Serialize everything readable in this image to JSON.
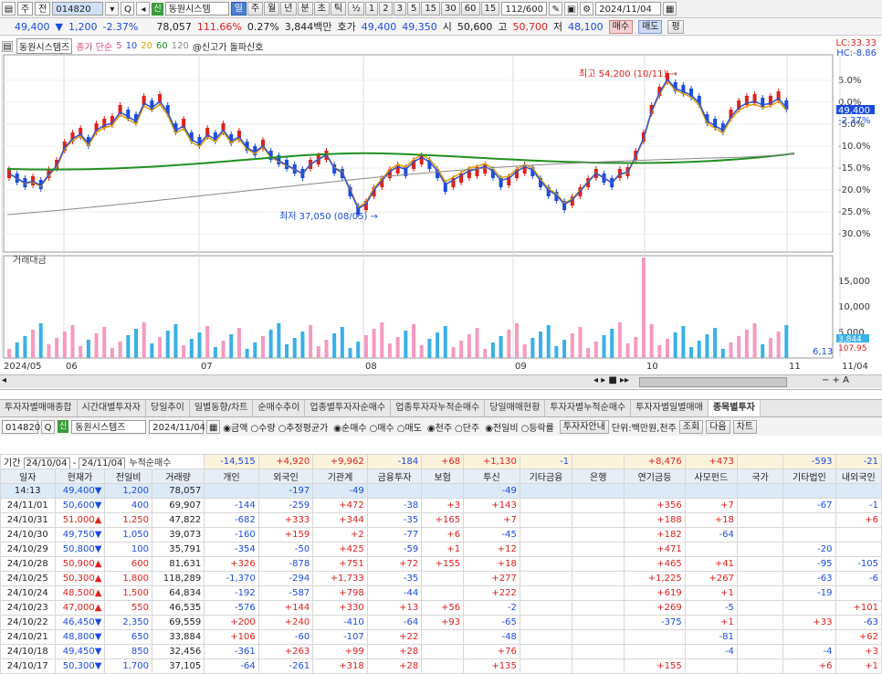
{
  "toolbar": {
    "mode": "주",
    "market": "전",
    "code": "014820",
    "name": "동원시스템",
    "periods": [
      "일",
      "주",
      "월",
      "년",
      "분",
      "초",
      "틱"
    ],
    "minutes": [
      "½",
      "1",
      "2",
      "3",
      "5",
      "15",
      "30",
      "60",
      "15"
    ],
    "count": "112/600",
    "date": "2024/11/04"
  },
  "info": {
    "price": "49,400",
    "change": "1,200",
    "rate": "-2.37%",
    "volume": "78,057",
    "vol_rate": "111.66%",
    "turnover": "0.27%",
    "amount": "3,844백만",
    "ask_label": "호가",
    "ask": "49,400",
    "bid": "49,350",
    "open_label": "시",
    "open": "50,600",
    "high_label": "고",
    "high": "50,700",
    "low_label": "저",
    "low": "48,100",
    "buy": "매수",
    "sell": "매도",
    "eval": "평"
  },
  "legend": {
    "name": "동원시스템즈",
    "ma_label": "종가 단순",
    "ma": [
      "5",
      "10",
      "20",
      "60",
      "120"
    ],
    "note": "@신고가 돌파신호",
    "lc": "LC:33.33",
    "hc": "HC:-8.86",
    "max_label": "최고 54,200 (10/11)",
    "min_label": "최저 37,050 (08/05)",
    "price_tag": "49,400",
    "price_rate": "-2.37%",
    "vol_title": "거래대금",
    "vol_tag": "3,844",
    "vol_rate_tag": "107.95",
    "vol_small": "6,13"
  },
  "chart_data": {
    "type": "candlestick",
    "y_pct_ticks": [
      "5.0%",
      "0.0%",
      "-5.0%",
      "-10.0%",
      "-15.0%",
      "-20.0%",
      "-25.0%",
      "-30.0%"
    ],
    "vol_ticks": [
      "15,000",
      "10,000",
      "5,000"
    ],
    "x_ticks": [
      "2024/05",
      "06",
      "07",
      "08",
      "09",
      "10",
      "11",
      "11/04"
    ]
  },
  "tabs": [
    "투자자별매매종합",
    "시간대별투자자",
    "당일추이",
    "일별동향/차트",
    "순매수추이",
    "업종별투자자순매수",
    "업종투자자누적순매수",
    "당일매매현황",
    "투자자별누적순매수",
    "투자자별일별매매",
    "종목별투자"
  ],
  "filter": {
    "code": "014820",
    "name": "동원시스템즈",
    "date": "2024/11/04",
    "r1": [
      "금액",
      "수량",
      "추정평균가"
    ],
    "r2": [
      "순매수",
      "매수",
      "매도"
    ],
    "r3": [
      "천주",
      "단주"
    ],
    "r4": [
      "전일비",
      "등락률"
    ],
    "btn_inv": "투자자안내",
    "unit": "단위:백만원,천주",
    "btn_q": "조회",
    "btn_next": "다음",
    "btn_chart": "차트"
  },
  "period": {
    "label": "기간",
    "from": "24/10/04",
    "to": "24/11/04",
    "acc": "누적순매수",
    "totals": [
      "-14,515",
      "+4,920",
      "+9,962",
      "-184",
      "+68",
      "+1,130",
      "-1",
      "",
      "+8,476",
      "+473",
      "",
      "-593",
      "-21"
    ]
  },
  "table": {
    "headers": [
      "일자",
      "현재가",
      "전일비",
      "거래량",
      "개인",
      "외국인",
      "기관계",
      "금융투자",
      "보험",
      "투신",
      "기타금융",
      "은행",
      "연기금등",
      "사모펀드",
      "국가",
      "기타법인",
      "내외국인"
    ],
    "rows": [
      [
        "14:13",
        "49,400▼",
        "1,200",
        "78,057",
        "",
        "-197",
        "-49",
        "",
        "",
        "-49",
        "",
        "",
        "",
        "",
        "",
        "",
        ""
      ],
      [
        "24/11/01",
        "50,600▼",
        "400",
        "69,907",
        "-144",
        "-259",
        "+472",
        "-38",
        "+3",
        "+143",
        "",
        "",
        "+356",
        "+7",
        "",
        "-67",
        "-1"
      ],
      [
        "24/10/31",
        "51,000▲",
        "1,250",
        "47,822",
        "-682",
        "+333",
        "+344",
        "-35",
        "+165",
        "+7",
        "",
        "",
        "+188",
        "+18",
        "",
        "",
        "+6"
      ],
      [
        "24/10/30",
        "49,750▼",
        "1,050",
        "39,073",
        "-160",
        "+159",
        "+2",
        "-77",
        "+6",
        "-45",
        "",
        "",
        "+182",
        "-64",
        "",
        "",
        ""
      ],
      [
        "24/10/29",
        "50,800▼",
        "100",
        "35,791",
        "-354",
        "-50",
        "+425",
        "-59",
        "+1",
        "+12",
        "",
        "",
        "+471",
        "",
        "",
        "-20",
        ""
      ],
      [
        "24/10/28",
        "50,900▲",
        "600",
        "81,631",
        "+326",
        "-878",
        "+751",
        "+72",
        "+155",
        "+18",
        "",
        "",
        "+465",
        "+41",
        "",
        "-95",
        "-105"
      ],
      [
        "24/10/25",
        "50,300▲",
        "1,800",
        "118,289",
        "-1,370",
        "-294",
        "+1,733",
        "-35",
        "",
        "+277",
        "",
        "",
        "+1,225",
        "+267",
        "",
        "-63",
        "-6"
      ],
      [
        "24/10/24",
        "48,500▲",
        "1,500",
        "64,834",
        "-192",
        "-587",
        "+798",
        "-44",
        "",
        "+222",
        "",
        "",
        "+619",
        "+1",
        "",
        "-19",
        ""
      ],
      [
        "24/10/23",
        "47,000▲",
        "550",
        "46,535",
        "-576",
        "+144",
        "+330",
        "+13",
        "+56",
        "-2",
        "",
        "",
        "+269",
        "-5",
        "",
        "",
        "+101"
      ],
      [
        "24/10/22",
        "46,450▼",
        "2,350",
        "69,559",
        "+200",
        "+240",
        "-410",
        "-64",
        "+93",
        "-65",
        "",
        "",
        "-375",
        "+1",
        "",
        "+33",
        "-63"
      ],
      [
        "24/10/21",
        "48,800▼",
        "650",
        "33,884",
        "+106",
        "-60",
        "-107",
        "+22",
        "",
        "-48",
        "",
        "",
        "",
        "-81",
        "",
        "",
        "+62"
      ],
      [
        "24/10/18",
        "49,450▼",
        "850",
        "32,456",
        "-361",
        "+263",
        "+99",
        "+28",
        "",
        "+76",
        "",
        "",
        "",
        "-4",
        "",
        "-4",
        "+3"
      ],
      [
        "24/10/17",
        "50,300▼",
        "1,700",
        "37,105",
        "-64",
        "-261",
        "+318",
        "+28",
        "",
        "+135",
        "",
        "",
        "+155",
        "",
        "",
        "+6",
        "+1"
      ]
    ]
  }
}
